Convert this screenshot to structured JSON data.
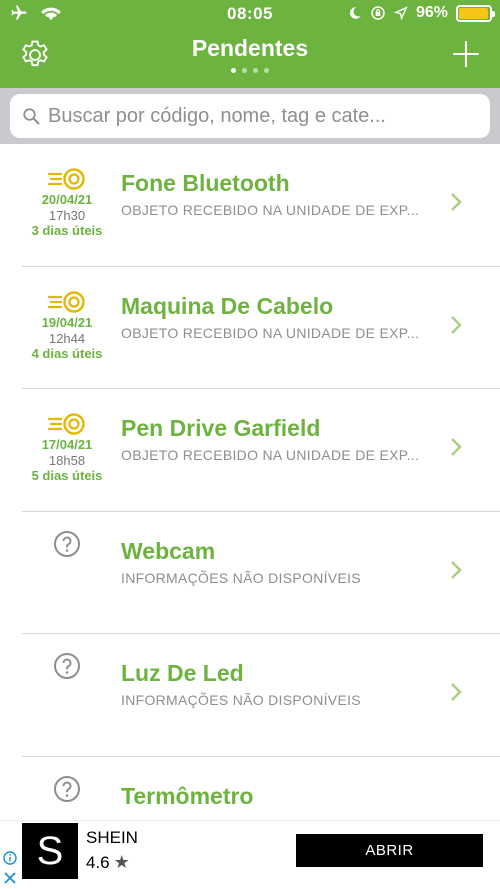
{
  "status_bar": {
    "time": "08:05",
    "battery_percent_label": "96%",
    "battery_level": 0.96,
    "battery_color": "#f5c518",
    "icons_left": [
      "airplane-icon",
      "wifi-icon"
    ],
    "icons_right": [
      "moon-icon",
      "rotation-lock-icon",
      "location-arrow-icon",
      "battery-icon"
    ]
  },
  "header": {
    "title": "Pendentes",
    "bg_color": "#6cb33f",
    "page_dots": 4,
    "active_dot": 0,
    "left_icon": "gear-icon",
    "right_icon": "plus-icon"
  },
  "search": {
    "placeholder": "Buscar por código, nome, tag e cate..."
  },
  "items": [
    {
      "name": "Fone Bluetooth",
      "status": "OBJETO RECEBIDO NA UNIDADE DE EXP...",
      "date": "20/04/21",
      "hour": "17h30",
      "days": "3 dias úteis",
      "icon": "delivery-truck-icon"
    },
    {
      "name": "Maquina De Cabelo",
      "status": "OBJETO RECEBIDO NA UNIDADE DE EXP...",
      "date": "19/04/21",
      "hour": "12h44",
      "days": "4 dias úteis",
      "icon": "delivery-truck-icon"
    },
    {
      "name": "Pen Drive Garfield",
      "status": "OBJETO RECEBIDO NA UNIDADE DE EXP...",
      "date": "17/04/21",
      "hour": "18h58",
      "days": "5 dias úteis",
      "icon": "delivery-truck-icon"
    },
    {
      "name": "Webcam",
      "status": "INFORMAÇÕES NÃO DISPONÍVEIS",
      "icon": "question-icon"
    },
    {
      "name": "Luz De Led",
      "status": "INFORMAÇÕES NÃO DISPONÍVEIS",
      "icon": "question-icon"
    },
    {
      "name": "Termômetro",
      "status": "",
      "icon": "question-icon"
    }
  ],
  "ad": {
    "logo_letter": "S",
    "app_name": "SHEIN",
    "rating": "4.6",
    "button_label": "ABRIR"
  }
}
